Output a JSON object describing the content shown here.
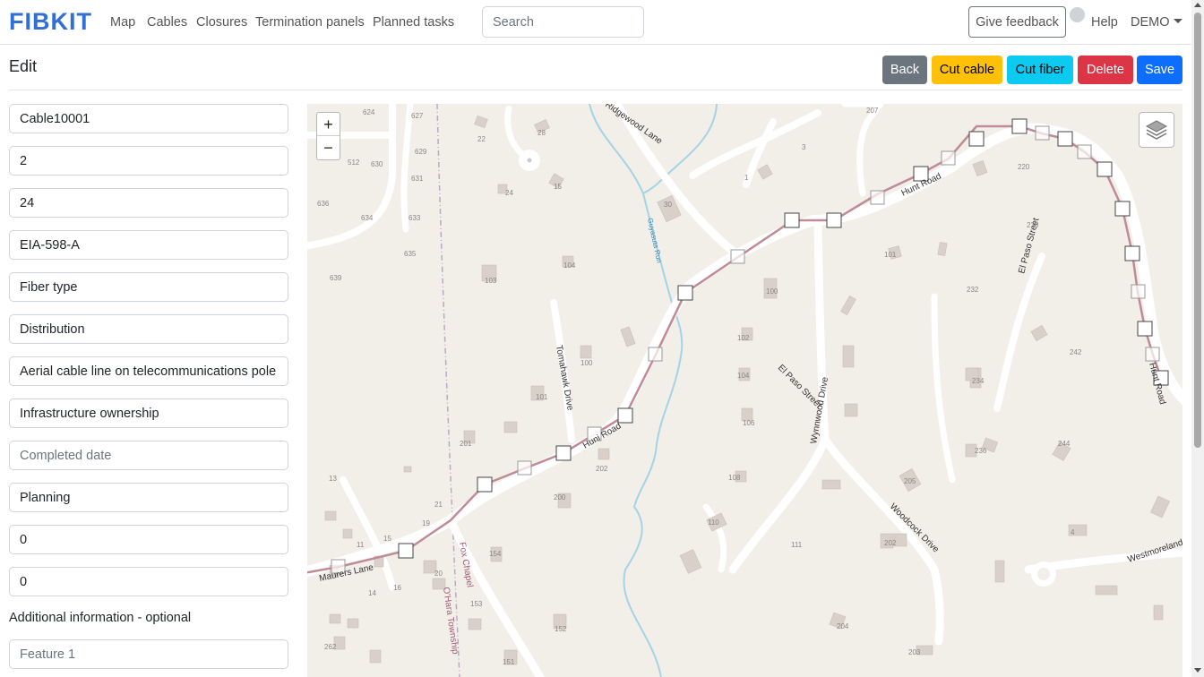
{
  "navbar": {
    "brand": "FIBKIT",
    "links": [
      "Map",
      "Cables",
      "Closures",
      "Termination panels",
      "Planned tasks"
    ],
    "search_placeholder": "Search",
    "feedback_label": "Give feedback",
    "help_label": "Help",
    "user_label": "DEMO"
  },
  "page": {
    "title": "Edit",
    "buttons": {
      "back": "Back",
      "cut_cable": "Cut cable",
      "cut_fiber": "Cut fiber",
      "delete": "Delete",
      "save": "Save"
    },
    "button_colors": {
      "back": "#6c757d",
      "cut_cable": "#ffc107",
      "cut_fiber": "#0dcaf0",
      "delete": "#dc3545",
      "save": "#0d6efd"
    }
  },
  "form": {
    "fields": [
      {
        "value": "Cable10001",
        "placeholder": ""
      },
      {
        "value": "2",
        "placeholder": ""
      },
      {
        "value": "24",
        "placeholder": ""
      },
      {
        "value": "EIA-598-A",
        "placeholder": ""
      },
      {
        "value": "Fiber type",
        "placeholder": ""
      },
      {
        "value": "Distribution",
        "placeholder": ""
      },
      {
        "value": "Aerial cable line on telecommunications pole fc",
        "placeholder": ""
      },
      {
        "value": "Infrastructure ownership",
        "placeholder": ""
      },
      {
        "value": "",
        "placeholder": "Completed date"
      },
      {
        "value": "Planning",
        "placeholder": ""
      },
      {
        "value": "0",
        "placeholder": ""
      },
      {
        "value": "0",
        "placeholder": ""
      }
    ],
    "additional_label": "Additional information - optional",
    "feature_placeholder": "Feature 1"
  },
  "map": {
    "streets": [
      "Hunt Road",
      "Huni Road",
      "Tomahawk Drive",
      "El Paso Street",
      "Wynnwood Drive",
      "Woodcock Drive",
      "Maurers Lane",
      "Westmoreland Fa",
      "Ridgewood Lane",
      "Fox Chapel",
      "O'Hara Township",
      "Guyasuta Run",
      "Hunt Road"
    ],
    "house_numbers": [
      "624",
      "627",
      "629",
      "631",
      "633",
      "634",
      "635",
      "636",
      "639",
      "630",
      "512",
      "22",
      "28",
      "24",
      "15",
      "30",
      "103",
      "104",
      "100",
      "101",
      "201",
      "202",
      "200",
      "100",
      "102",
      "104",
      "106",
      "108",
      "110",
      "111",
      "101",
      "232",
      "234",
      "236",
      "244",
      "242",
      "230",
      "220",
      "207",
      "3",
      "1",
      "205",
      "202",
      "204",
      "203",
      "4",
      "154",
      "153",
      "152",
      "151",
      "13",
      "21",
      "19",
      "20",
      "14",
      "16",
      "11",
      "15",
      "262"
    ],
    "cable_color": "#c08a96"
  }
}
